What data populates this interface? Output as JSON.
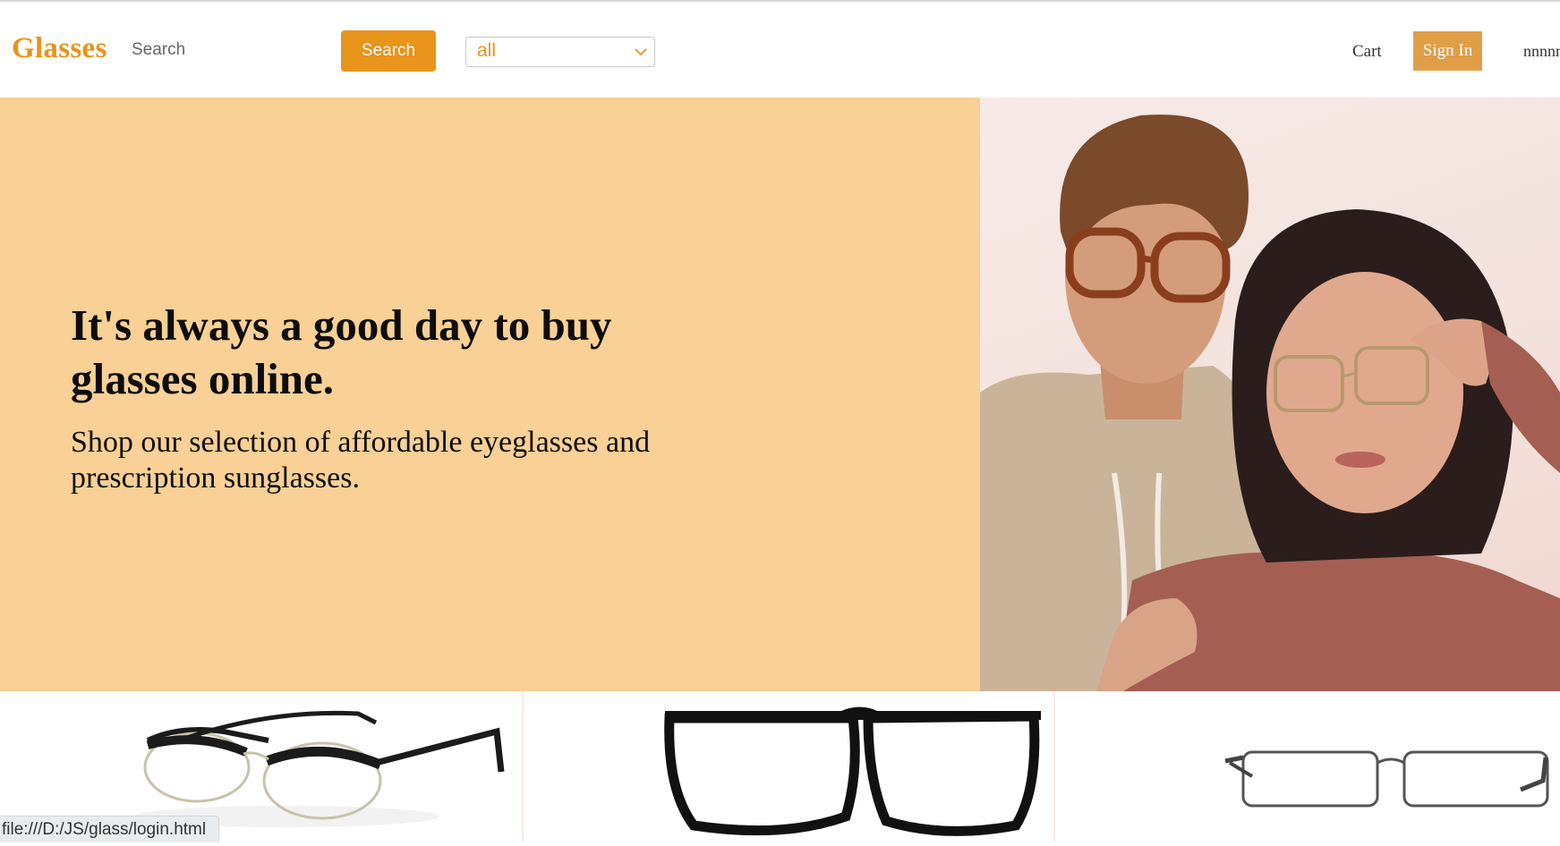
{
  "header": {
    "logo": "Glasses",
    "search_placeholder": "Search",
    "search_button": "Search",
    "category": "all",
    "cart": "Cart",
    "sign_in": "Sign In",
    "username": "nnnnn"
  },
  "hero": {
    "title": "It's always a good day to buy glasses online.",
    "subtitle": "Shop our selection of affordable eyeglasses and prescription sunglasses."
  },
  "status_bar": {
    "url": "file:///D:/JS/glass/login.html"
  },
  "colors": {
    "accent": "#e8931a",
    "signin": "#e09f47",
    "hero_bg": "#f9d095"
  }
}
